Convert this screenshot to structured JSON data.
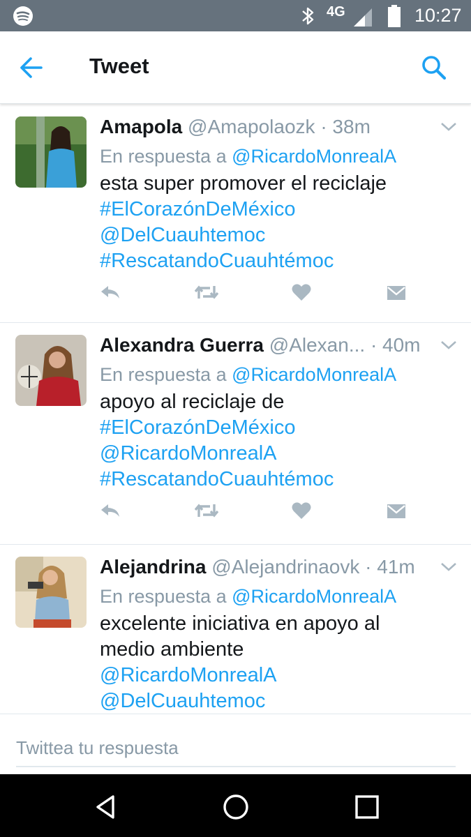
{
  "status_bar": {
    "network": "4G",
    "time": "10:27",
    "icons": [
      "spotify-icon",
      "bluetooth-icon",
      "signal-icon",
      "battery-icon"
    ]
  },
  "app_bar": {
    "title": "Tweet",
    "icons": [
      "back-arrow-icon",
      "search-icon"
    ]
  },
  "colors": {
    "link": "#1da1f2",
    "muted": "#8899a6",
    "text": "#14171a",
    "status_bar": "#66727d",
    "action_icon": "#aab8c2"
  },
  "tweets": [
    {
      "name": "Amapola",
      "handle": "@Amapolaozk",
      "time": "· 38m",
      "reply_prefix": "En respuesta a",
      "reply_mention": "@RicardoMonrealA",
      "lines": [
        {
          "text": "esta super promover el reciclaje",
          "kind": "text"
        },
        {
          "text": "#ElCorazónDeMéxico",
          "kind": "link"
        },
        {
          "text": "@DelCuauhtemoc",
          "kind": "link"
        },
        {
          "text": "#RescatandoCuauhtémoc",
          "kind": "link"
        }
      ]
    },
    {
      "name": "Alexandra Guerra",
      "handle": "@Alexan...",
      "time": "· 40m",
      "reply_prefix": "En respuesta a",
      "reply_mention": "@RicardoMonrealA",
      "lines": [
        {
          "text": "apoyo al reciclaje de",
          "kind": "text"
        },
        {
          "text": "#ElCorazónDeMéxico",
          "kind": "link"
        },
        {
          "text": "@RicardoMonrealA",
          "kind": "link"
        },
        {
          "text": "#RescatandoCuauhtémoc",
          "kind": "link"
        }
      ]
    },
    {
      "name": "Alejandrina",
      "handle": "@Alejandrinaovk",
      "time": "· 41m",
      "reply_prefix": "En respuesta a",
      "reply_mention": "@RicardoMonrealA",
      "lines": [
        {
          "text": "excelente iniciativa en apoyo al",
          "kind": "text"
        },
        {
          "text": "medio ambiente",
          "kind": "text"
        },
        {
          "text": "@RicardoMonrealA",
          "kind": "link"
        },
        {
          "text": "@DelCuauhtemoc",
          "kind": "link"
        }
      ]
    }
  ],
  "tweet_actions": [
    "reply-icon",
    "retweet-icon",
    "like-icon",
    "direct-message-icon"
  ],
  "reply_bar": {
    "placeholder": "Twittea tu respuesta",
    "value": ""
  },
  "nav_bar": {
    "buttons": [
      "back-triangle-icon",
      "home-circle-icon",
      "recents-square-icon"
    ]
  }
}
